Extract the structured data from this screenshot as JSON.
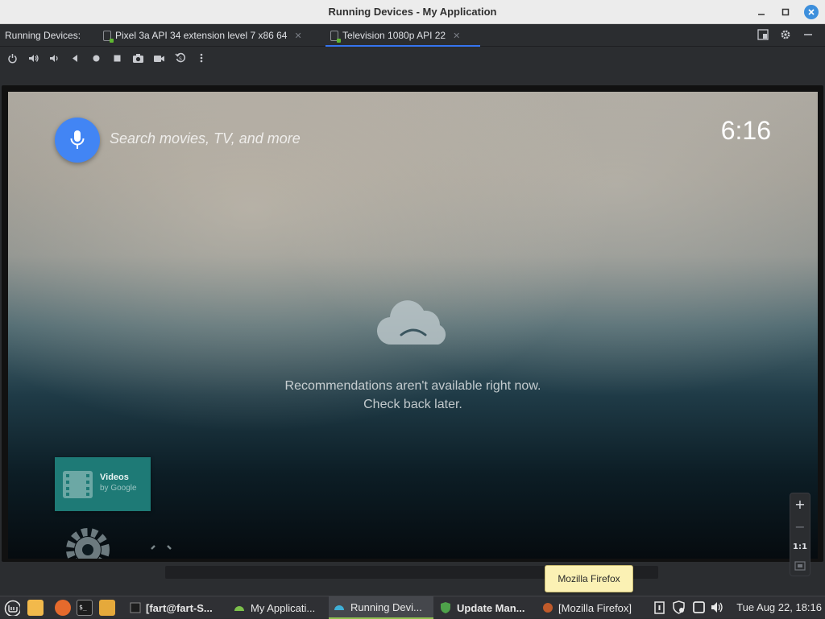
{
  "window": {
    "title": "Running Devices - My Application",
    "close_color": "#3d8fdc"
  },
  "tabbar": {
    "label": "Running Devices:",
    "tabs": [
      {
        "label": "Pixel 3a API 34 extension level 7 x86 64",
        "active": false
      },
      {
        "label": "Television 1080p API 22",
        "active": true
      }
    ],
    "accent": "#3574f0"
  },
  "toolbar": {
    "icons": [
      "power-icon",
      "volume-up-icon",
      "volume-down-icon",
      "back-icon",
      "home-icon",
      "overview-icon",
      "screenshot-icon",
      "screen-record-icon",
      "reset-icon",
      "more-icon"
    ]
  },
  "tv": {
    "search_placeholder": "Search movies, TV, and more",
    "clock": "6:16",
    "message_line1": "Recommendations aren't available right now.",
    "message_line2": "Check back later.",
    "app_tile_name": "Videos",
    "app_tile_sub": "by Google",
    "mic_color": "#4285f4",
    "tile_color": "#1e7a76"
  },
  "zoom": {
    "zoom_in": "+",
    "zoom_out": "−",
    "actual_size": "1:1"
  },
  "tooltip": "Mozilla Firefox",
  "taskbar": {
    "items": [
      {
        "label": "[fart@fart-S..."
      },
      {
        "label": "My Applicati..."
      },
      {
        "label": "Running Devi..."
      },
      {
        "label": "Update Man..."
      },
      {
        "label": "[Mozilla Firefox]"
      }
    ],
    "datetime": "Tue Aug 22, 18:16"
  }
}
